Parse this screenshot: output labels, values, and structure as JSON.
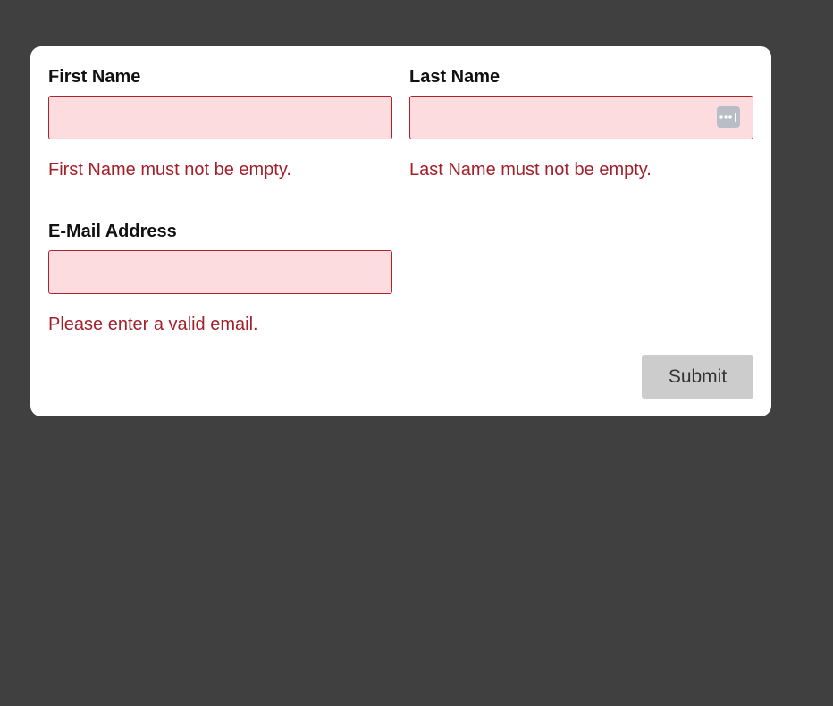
{
  "form": {
    "first_name": {
      "label": "First Name",
      "value": "",
      "placeholder": "",
      "error": "First Name must not be empty."
    },
    "last_name": {
      "label": "Last Name",
      "value": "",
      "placeholder": "",
      "error": "Last Name must not be empty."
    },
    "email": {
      "label": "E-Mail Address",
      "value": "",
      "placeholder": "",
      "error": "Please enter a valid email."
    },
    "submit_label": "Submit"
  },
  "icons": {
    "autofill": "password-manager-autofill-icon"
  },
  "colors": {
    "page_background": "#404040",
    "card_background": "#ffffff",
    "error_text": "#a3202a",
    "input_error_border": "#b3212b",
    "input_error_background": "#fcdcdf",
    "submit_background": "#cccccc"
  }
}
